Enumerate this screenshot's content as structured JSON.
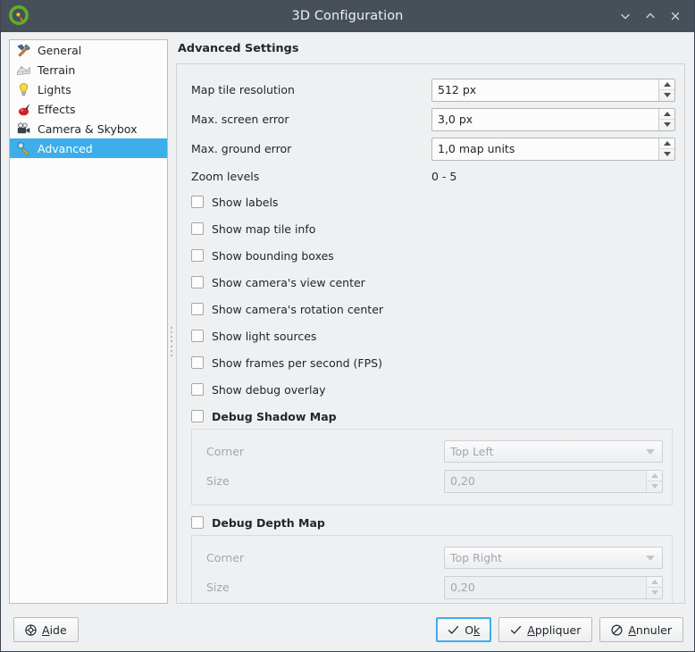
{
  "window": {
    "title": "3D Configuration",
    "logo_icon": "qgis-logo-icon",
    "controls": [
      {
        "name": "minimize-button",
        "icon": "chevron-down-icon"
      },
      {
        "name": "maximize-button",
        "icon": "chevron-up-icon"
      },
      {
        "name": "close-button",
        "icon": "close-icon"
      }
    ]
  },
  "sidebar": {
    "items": [
      {
        "label": "General",
        "icon": "tools-icon",
        "selected": false
      },
      {
        "label": "Terrain",
        "icon": "terrain-grid-icon",
        "selected": false
      },
      {
        "label": "Lights",
        "icon": "lightbulb-icon",
        "selected": false
      },
      {
        "label": "Effects",
        "icon": "effects-ball-icon",
        "selected": false
      },
      {
        "label": "Camera & Skybox",
        "icon": "camera-icon",
        "selected": false
      },
      {
        "label": "Advanced",
        "icon": "wrench-gear-icon",
        "selected": true
      }
    ]
  },
  "pane": {
    "title": "Advanced Settings",
    "fields": [
      {
        "label": "Map tile resolution",
        "value": "512 px"
      },
      {
        "label": "Max. screen error",
        "value": "3,0 px"
      },
      {
        "label": "Max. ground error",
        "value": "1,0 map units"
      }
    ],
    "zoom_levels": {
      "label": "Zoom levels",
      "value": "0 - 5"
    },
    "checkboxes": [
      {
        "label": "Show labels",
        "checked": false
      },
      {
        "label": "Show map tile info",
        "checked": false
      },
      {
        "label": "Show bounding boxes",
        "checked": false
      },
      {
        "label": "Show camera's view center",
        "checked": false
      },
      {
        "label": "Show camera's rotation center",
        "checked": false
      },
      {
        "label": "Show light sources",
        "checked": false
      },
      {
        "label": "Show frames per second (FPS)",
        "checked": false
      },
      {
        "label": "Show debug overlay",
        "checked": false
      }
    ],
    "shadow_group": {
      "title": "Debug Shadow Map",
      "checked": false,
      "corner_label": "Corner",
      "corner_value": "Top Left",
      "size_label": "Size",
      "size_value": "0,20"
    },
    "depth_group": {
      "title": "Debug Depth Map",
      "checked": false,
      "corner_label": "Corner",
      "corner_value": "Top Right",
      "size_label": "Size",
      "size_value": "0,20"
    }
  },
  "buttons": {
    "help": {
      "label": "Aide",
      "accel": "A",
      "rest": "ide",
      "icon": "help-lifebuoy-icon"
    },
    "ok": {
      "label": "Ok",
      "lead": "O",
      "accel": "k",
      "rest": "",
      "icon": "check-icon",
      "focused": true
    },
    "apply": {
      "label": "Appliquer",
      "accel": "A",
      "rest": "ppliquer",
      "icon": "check-icon"
    },
    "cancel": {
      "label": "Annuler",
      "accel": "A",
      "rest": "nnuler",
      "icon": "cancel-circle-icon"
    }
  },
  "colors": {
    "titlebar": "#475059",
    "selection": "#3daee9",
    "background": "#eff0f1"
  }
}
